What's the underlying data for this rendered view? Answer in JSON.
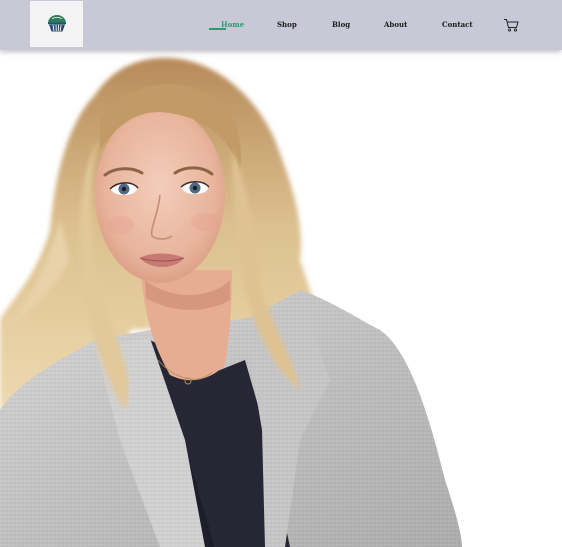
{
  "header": {
    "logo_icon": "globe-basket-logo-icon",
    "nav": [
      {
        "label": "Home",
        "active": true
      },
      {
        "label": "Shop",
        "active": false
      },
      {
        "label": "Blog",
        "active": false
      },
      {
        "label": "About",
        "active": false
      },
      {
        "label": "Contact",
        "active": false
      }
    ],
    "cart_icon": "shopping-cart-icon"
  },
  "colors": {
    "header_bg": "#c8c8d6",
    "accent": "#2e9a6f",
    "logo_green": "#2e7d5a",
    "logo_blue": "#1f4f7a"
  },
  "hero": {
    "image": "photo of a blonde woman wearing a light grey linen blazer over a dark top"
  }
}
